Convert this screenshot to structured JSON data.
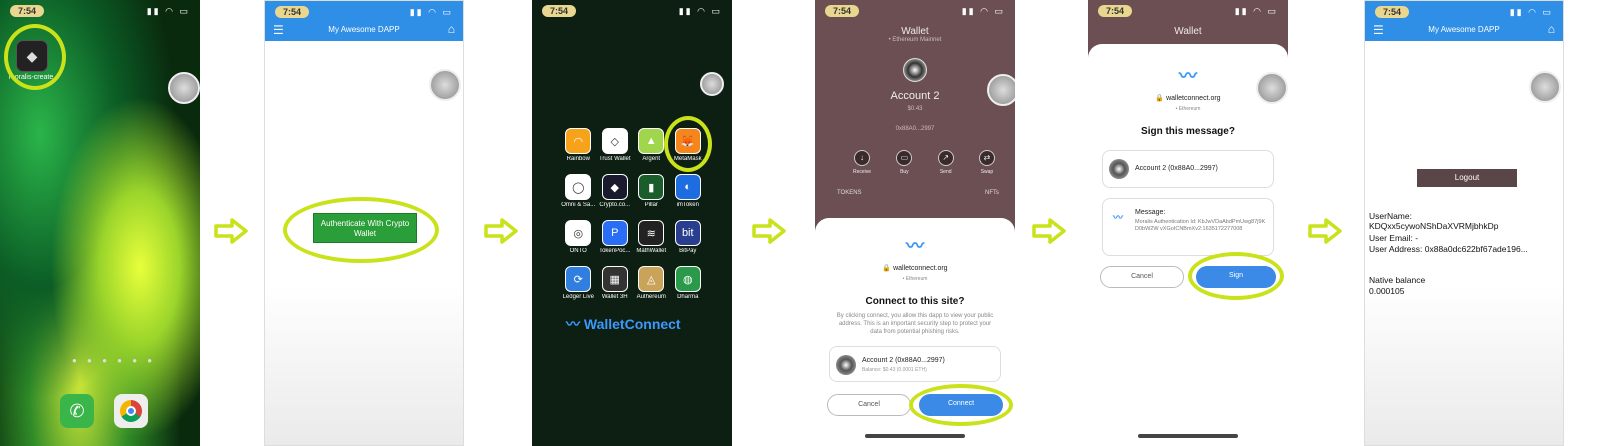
{
  "status": {
    "time": "7:54"
  },
  "phone1": {
    "app_label": "moralis-create..."
  },
  "dapp": {
    "title": "My Awesome DAPP",
    "auth_button": "Authenticate With Crypto Wallet"
  },
  "wallets": {
    "items": [
      "Rainbow",
      "Trust Wallet",
      "Argent",
      "MetaMask",
      "Omni & Sa...",
      "Crypto.co...",
      "Pillar",
      "imToken",
      "ONTO",
      "TokenPoc...",
      "MathWallet",
      "BitPay",
      "Ledger Live",
      "Wallet 3H",
      "Authereum",
      "Dharma"
    ],
    "brand": "WalletConnect"
  },
  "walletapp": {
    "title": "Wallet",
    "subtitle": "• Ethereum Mainnet",
    "account": "Account 2",
    "balance": "$0.43",
    "address": "0x88A0...2997",
    "actions": [
      "Receive",
      "Buy",
      "Send",
      "Swap"
    ],
    "tokens": [
      "TOKENS",
      "NFTs"
    ]
  },
  "connect": {
    "domain": "walletconnect.org",
    "chain": "• Ethereum",
    "heading": "Connect to this site?",
    "description": "By clicking connect, you allow this dapp to view your public address. This is an important security step to protect your data from potential phishing risks.",
    "account_name": "Account 2 (0x88A0...2997)",
    "account_balance": "Balance: $0.43 (0.0001 ETH)",
    "cancel": "Cancel",
    "confirm": "Connect"
  },
  "sign": {
    "domain": "walletconnect.org",
    "chain": "• Ethereum",
    "heading": "Sign this message?",
    "account_name": "Account 2 (0x88A0...2997)",
    "message_label": "Message:",
    "message_text": "Moralis Authentication Id: KbJwVDaAbdPmUwg87j9KD0bW2W vXGoICNBmXv2:1635172277008",
    "cancel": "Cancel",
    "confirm": "Sign"
  },
  "result": {
    "logout": "Logout",
    "username": "UserName: KDQxx5cywoNShDaXVRMjbhkDp",
    "email": "User Email: -",
    "address": "User Address: 0x88a0dc622bf67ade196...",
    "balance_label": "Native balance",
    "balance_value": "0.000105"
  },
  "colors": {
    "accent": "#c9e21a",
    "appbar": "#2f8ee5",
    "walletconnect": "#3b99fc"
  }
}
